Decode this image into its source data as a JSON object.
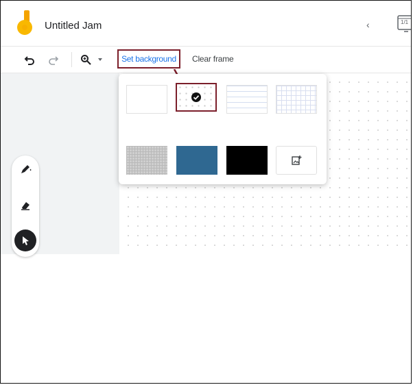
{
  "app": {
    "title": "Untitled Jam",
    "page_indicator": "1/1"
  },
  "toolbar": {
    "undo_icon": "undo-icon",
    "redo_icon": "redo-icon",
    "zoom_icon": "zoom-icon",
    "set_background_label": "Set background",
    "clear_frame_label": "Clear frame"
  },
  "background_options": [
    {
      "name": "blank",
      "color": "#ffffff"
    },
    {
      "name": "dotted",
      "selected": true
    },
    {
      "name": "lined"
    },
    {
      "name": "grid"
    },
    {
      "name": "gray-grid",
      "color": "#cfcfcf"
    },
    {
      "name": "blue",
      "color": "#2f6891"
    },
    {
      "name": "black",
      "color": "#000000"
    },
    {
      "name": "upload-image",
      "icon": "add-image-icon"
    }
  ],
  "tools": [
    {
      "name": "pen",
      "icon": "pen-icon"
    },
    {
      "name": "eraser",
      "icon": "eraser-icon"
    },
    {
      "name": "select",
      "icon": "cursor-icon",
      "active": true
    }
  ],
  "colors": {
    "accent": "#1a73e8",
    "highlight_border": "#7b1e2a",
    "logo_orange": "#f4a300"
  }
}
